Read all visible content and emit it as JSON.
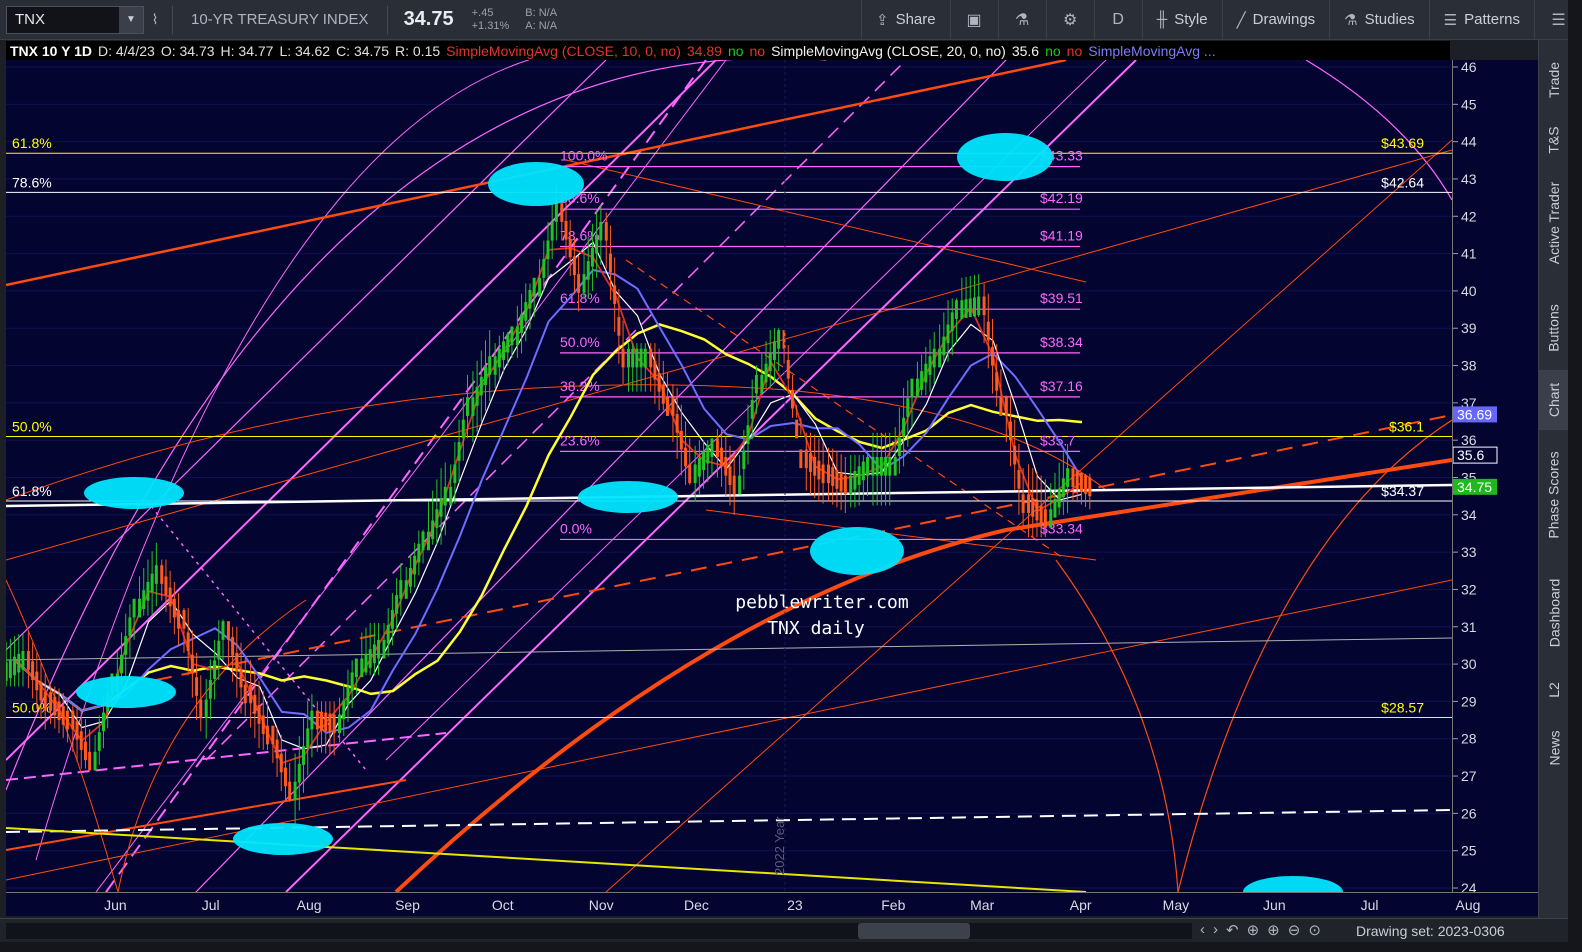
{
  "toolbar": {
    "symbol": "TNX",
    "description": "10-YR TREASURY INDEX",
    "last": "34.75",
    "net_change": "+.45",
    "pct_change": "+1.31%",
    "bid": "B: N/A",
    "ask": "A: N/A",
    "share": "Share",
    "aggregation": "D",
    "style": "Style",
    "drawings": "Drawings",
    "studies": "Studies",
    "patterns": "Patterns"
  },
  "infobar": {
    "title": "TNX 10 Y 1D",
    "date": "D: 4/4/23",
    "open": "O: 34.73",
    "high": "H: 34.77",
    "low": "L: 34.62",
    "close": "C: 34.75",
    "range": "R: 0.15",
    "sma1": "SimpleMovingAvg (CLOSE, 10, 0, no)",
    "sma1_val": "34.89",
    "sma2": "SimpleMovingAvg (CLOSE, 20, 0, no)",
    "sma2_val": "35.6",
    "sma3": "SimpleMovingAvg ...",
    "no": "no"
  },
  "right_tabs": [
    "Trade",
    "T&S",
    "Active Trader",
    "Buttons",
    "Chart",
    "Phase Scores",
    "Dashboard",
    "L2",
    "News"
  ],
  "bottom": {
    "drawing_set": "Drawing set: 2023-0306"
  },
  "chart_data": {
    "type": "candlestick",
    "title": "TNX daily",
    "watermark": "pebblewriter.com",
    "year_marker": "2022 Year",
    "ylim": [
      24,
      46
    ],
    "y_ticks": [
      "46",
      "45",
      "44",
      "43",
      "42",
      "41",
      "40",
      "39",
      "38",
      "37",
      "36",
      "35",
      "34",
      "33",
      "32",
      "31",
      "30",
      "29",
      "28",
      "27",
      "26",
      "25",
      "24"
    ],
    "x_labels": [
      "Jun",
      "Jul",
      "Aug",
      "Sep",
      "Oct",
      "Nov",
      "Dec",
      "23",
      "Feb",
      "Mar",
      "Apr",
      "May",
      "Jun",
      "Jul",
      "Aug"
    ],
    "fib_levels_right": [
      {
        "label": "100.0%",
        "price": "$43.33",
        "value": 43.33
      },
      {
        "label": "88.6%",
        "price": "$42.19",
        "value": 42.19
      },
      {
        "label": "78.6%",
        "price": "$41.19",
        "value": 41.19
      },
      {
        "label": "61.8%",
        "price": "$39.51",
        "value": 39.51
      },
      {
        "label": "50.0%",
        "price": "$38.34",
        "value": 38.34
      },
      {
        "label": "38.2%",
        "price": "$37.16",
        "value": 37.16
      },
      {
        "label": "23.6%",
        "price": "$35.7",
        "value": 35.7
      },
      {
        "label": "0.0%",
        "price": "$33.34",
        "value": 33.34
      }
    ],
    "fib_levels_left": [
      {
        "label": "61.8%",
        "price": "$43.69",
        "value": 43.69,
        "color": "#ffff00"
      },
      {
        "label": "78.6%",
        "price": "$42.64",
        "value": 42.64,
        "color": "#ffffff"
      },
      {
        "label": "50.0%",
        "price": "$36.1",
        "value": 36.1,
        "color": "#ffff00"
      },
      {
        "label": "61.8%",
        "price": "$34.37",
        "value": 34.37,
        "color": "#ffffff"
      },
      {
        "label": "50.0%",
        "price": "$28.57",
        "value": 28.57,
        "color": "#ffff00"
      }
    ],
    "price_badges": [
      {
        "label": "36.69",
        "value": 36.69,
        "color": "#6666ff"
      },
      {
        "label": "35.6",
        "value": 35.6,
        "color": "#ffffff"
      },
      {
        "label": "34.75",
        "value": 34.75,
        "color": "#1fb81f"
      }
    ],
    "ohlc": [
      [
        "2022-05-02",
        29.8,
        30.8,
        29.4,
        30.1
      ],
      [
        "2022-05-09",
        30.1,
        31.5,
        28.1,
        29.0
      ],
      [
        "2022-05-16",
        29.0,
        29.4,
        27.7,
        28.5
      ],
      [
        "2022-05-23",
        28.5,
        28.9,
        27.2,
        27.4
      ],
      [
        "2022-05-30",
        27.4,
        29.6,
        27.3,
        29.5
      ],
      [
        "2022-06-06",
        29.5,
        31.6,
        29.3,
        31.5
      ],
      [
        "2022-06-13",
        31.5,
        34.9,
        31.3,
        32.4
      ],
      [
        "2022-06-20",
        32.4,
        32.8,
        30.0,
        31.2
      ],
      [
        "2022-06-27",
        31.2,
        31.5,
        28.2,
        28.8
      ],
      [
        "2022-07-04",
        28.8,
        31.2,
        27.8,
        30.9
      ],
      [
        "2022-07-11",
        30.9,
        31.0,
        28.6,
        29.2
      ],
      [
        "2022-07-18",
        29.2,
        30.6,
        27.7,
        28.1
      ],
      [
        "2022-07-25",
        28.1,
        28.3,
        26.3,
        26.6
      ],
      [
        "2022-08-01",
        26.6,
        29.2,
        25.7,
        28.5
      ],
      [
        "2022-08-08",
        28.5,
        29.0,
        27.3,
        28.4
      ],
      [
        "2022-08-15",
        28.4,
        30.1,
        27.9,
        29.9
      ],
      [
        "2022-08-22",
        29.9,
        31.1,
        29.7,
        30.4
      ],
      [
        "2022-08-29",
        30.4,
        33.3,
        30.2,
        32.0
      ],
      [
        "2022-09-05",
        32.0,
        33.6,
        31.9,
        33.3
      ],
      [
        "2022-09-12",
        33.3,
        35.4,
        33.2,
        34.5
      ],
      [
        "2022-09-19",
        34.5,
        38.5,
        34.3,
        36.9
      ],
      [
        "2022-09-26",
        36.9,
        40.0,
        35.2,
        38.0
      ],
      [
        "2022-10-03",
        38.0,
        38.9,
        35.6,
        38.8
      ],
      [
        "2022-10-10",
        38.8,
        40.2,
        38.2,
        40.1
      ],
      [
        "2022-10-17",
        40.1,
        43.3,
        40.0,
        42.1
      ],
      [
        "2022-10-24",
        42.1,
        42.6,
        38.8,
        40.2
      ],
      [
        "2022-10-31",
        40.2,
        42.3,
        39.8,
        41.6
      ],
      [
        "2022-11-07",
        41.6,
        42.1,
        37.5,
        38.2
      ],
      [
        "2022-11-14",
        38.2,
        38.6,
        36.8,
        38.2
      ],
      [
        "2022-11-21",
        38.2,
        38.6,
        36.8,
        36.9
      ],
      [
        "2022-11-28",
        36.9,
        37.5,
        34.8,
        35.1
      ],
      [
        "2022-12-05",
        35.1,
        36.0,
        34.0,
        35.8
      ],
      [
        "2022-12-12",
        35.8,
        36.3,
        34.0,
        34.8
      ],
      [
        "2022-12-19",
        34.8,
        38.0,
        34.6,
        37.5
      ],
      [
        "2022-12-26",
        37.5,
        39.0,
        37.4,
        38.7
      ],
      [
        "2023-01-02",
        38.7,
        38.8,
        36.6,
        35.5
      ],
      [
        "2023-01-09",
        35.5,
        36.2,
        34.3,
        35.1
      ],
      [
        "2023-01-16",
        35.1,
        35.8,
        33.4,
        34.8
      ],
      [
        "2023-01-23",
        34.8,
        35.6,
        34.2,
        35.3
      ],
      [
        "2023-01-30",
        35.3,
        36.2,
        33.4,
        35.3
      ],
      [
        "2023-02-06",
        35.3,
        37.6,
        35.1,
        37.4
      ],
      [
        "2023-02-13",
        37.4,
        38.9,
        37.2,
        38.2
      ],
      [
        "2023-02-20",
        38.2,
        39.8,
        38.1,
        39.5
      ],
      [
        "2023-02-27",
        39.5,
        40.9,
        39.3,
        39.6
      ],
      [
        "2023-03-06",
        39.6,
        40.2,
        36.9,
        36.9
      ],
      [
        "2023-03-13",
        36.9,
        37.2,
        33.7,
        34.3
      ],
      [
        "2023-03-20",
        34.3,
        35.9,
        33.4,
        33.9
      ],
      [
        "2023-03-27",
        33.9,
        35.9,
        34.0,
        35.0
      ],
      [
        "2023-04-03",
        35.0,
        35.1,
        34.1,
        34.75
      ]
    ]
  }
}
